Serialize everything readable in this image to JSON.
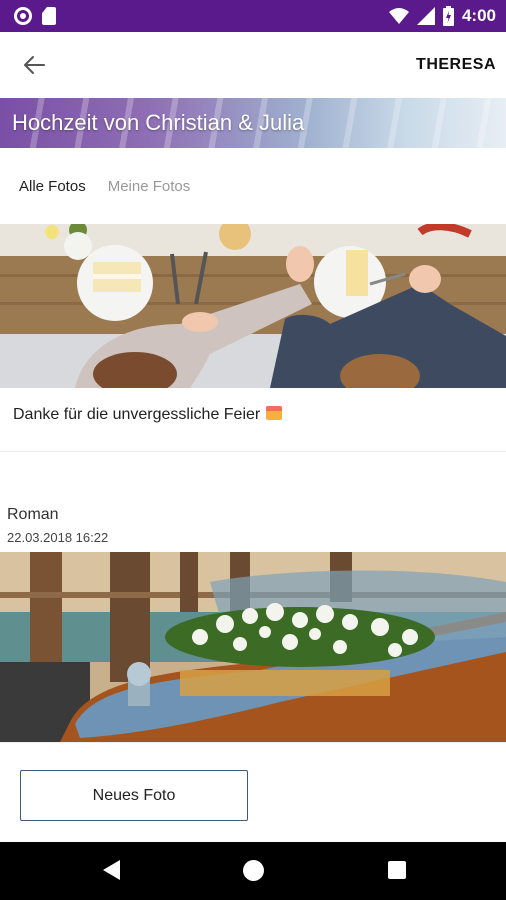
{
  "status_bar": {
    "time": "4:00"
  },
  "app_bar": {
    "user": "THERESA"
  },
  "banner": {
    "title": "Hochzeit von Christian & Julia"
  },
  "tabs": [
    {
      "label": "Alle Fotos",
      "active": true
    },
    {
      "label": "Meine Fotos",
      "active": false
    }
  ],
  "posts": [
    {
      "caption": "Danke für die unvergessliche Feier"
    },
    {
      "author": "Roman",
      "date": "22.03.2018 16:22"
    }
  ],
  "actions": {
    "new_photo": "Neues Foto"
  },
  "colors": {
    "status_bar": "#5a1a8c",
    "button_border": "#3c5c7a"
  }
}
